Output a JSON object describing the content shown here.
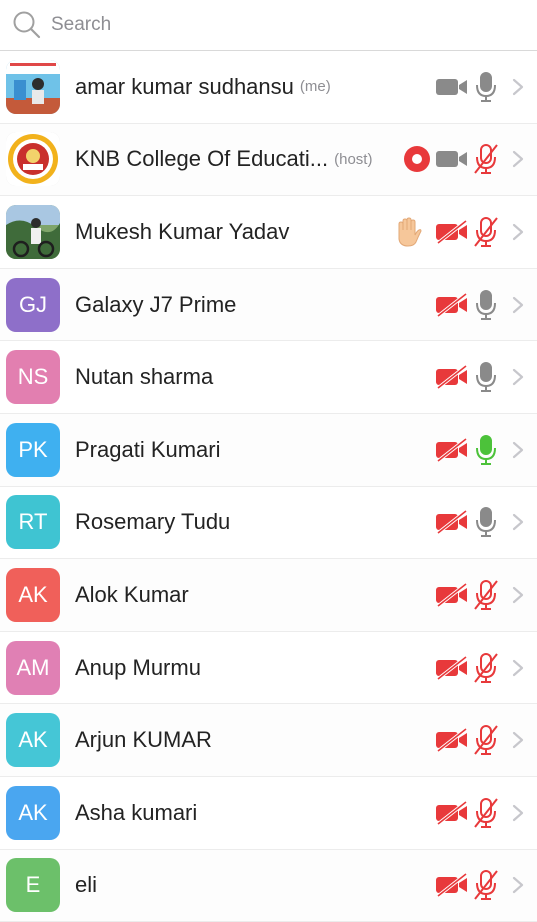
{
  "search": {
    "placeholder": "Search"
  },
  "participants": [
    {
      "name": "amar kumar sudhansu",
      "tag": "(me)",
      "avatar_type": "photo",
      "initials": "",
      "avatar_color": "#3aa0c8",
      "video": "on",
      "mic": "on",
      "mic_active": false,
      "recording": false,
      "hand_raised": false
    },
    {
      "name": "KNB College Of Educati...",
      "tag": "(host)",
      "avatar_type": "logo",
      "initials": "",
      "avatar_color": "#f2b21c",
      "video": "on",
      "mic": "off",
      "mic_active": false,
      "recording": true,
      "hand_raised": false
    },
    {
      "name": "Mukesh Kumar Yadav",
      "tag": "",
      "avatar_type": "photo",
      "initials": "",
      "avatar_color": "#6b8b4f",
      "video": "off",
      "mic": "off",
      "mic_active": false,
      "recording": false,
      "hand_raised": true
    },
    {
      "name": "Galaxy J7 Prime",
      "tag": "",
      "avatar_type": "initials",
      "initials": "GJ",
      "avatar_color": "#8e6fc9",
      "video": "off",
      "mic": "on",
      "mic_active": false,
      "recording": false,
      "hand_raised": false
    },
    {
      "name": "Nutan sharma",
      "tag": "",
      "avatar_type": "initials",
      "initials": "NS",
      "avatar_color": "#e27fb0",
      "video": "off",
      "mic": "on",
      "mic_active": false,
      "recording": false,
      "hand_raised": false
    },
    {
      "name": "Pragati Kumari",
      "tag": "",
      "avatar_type": "initials",
      "initials": "PK",
      "avatar_color": "#3fb0f0",
      "video": "off",
      "mic": "on",
      "mic_active": true,
      "recording": false,
      "hand_raised": false
    },
    {
      "name": "Rosemary Tudu",
      "tag": "",
      "avatar_type": "initials",
      "initials": "RT",
      "avatar_color": "#3fc4d2",
      "video": "off",
      "mic": "on",
      "mic_active": false,
      "recording": false,
      "hand_raised": false
    },
    {
      "name": "Alok Kumar",
      "tag": "",
      "avatar_type": "initials",
      "initials": "AK",
      "avatar_color": "#f0605a",
      "video": "off",
      "mic": "off",
      "mic_active": false,
      "recording": false,
      "hand_raised": false
    },
    {
      "name": "Anup Murmu",
      "tag": "",
      "avatar_type": "initials",
      "initials": "AM",
      "avatar_color": "#e080b4",
      "video": "off",
      "mic": "off",
      "mic_active": false,
      "recording": false,
      "hand_raised": false
    },
    {
      "name": "Arjun KUMAR",
      "tag": "",
      "avatar_type": "initials",
      "initials": "AK",
      "avatar_color": "#45c6d6",
      "video": "off",
      "mic": "off",
      "mic_active": false,
      "recording": false,
      "hand_raised": false
    },
    {
      "name": "Asha kumari",
      "tag": "",
      "avatar_type": "initials",
      "initials": "AK",
      "avatar_color": "#4aa6f0",
      "video": "off",
      "mic": "off",
      "mic_active": false,
      "recording": false,
      "hand_raised": false
    },
    {
      "name": "eli",
      "tag": "",
      "avatar_type": "initials",
      "initials": "E",
      "avatar_color": "#6cc06a",
      "video": "off",
      "mic": "off",
      "mic_active": false,
      "recording": false,
      "hand_raised": false
    }
  ],
  "colors": {
    "muted_red": "#e8393b",
    "icon_gray": "#8a8a8a",
    "speaking_green": "#4cc23a",
    "chevron": "#c7c7cc"
  },
  "icons": {
    "search": "search-icon",
    "video_on": "video-camera-icon",
    "video_off": "video-camera-off-icon",
    "mic_on": "microphone-icon",
    "mic_off": "microphone-off-icon",
    "record": "record-icon",
    "hand": "raised-hand-icon",
    "chevron": "chevron-right-icon"
  }
}
